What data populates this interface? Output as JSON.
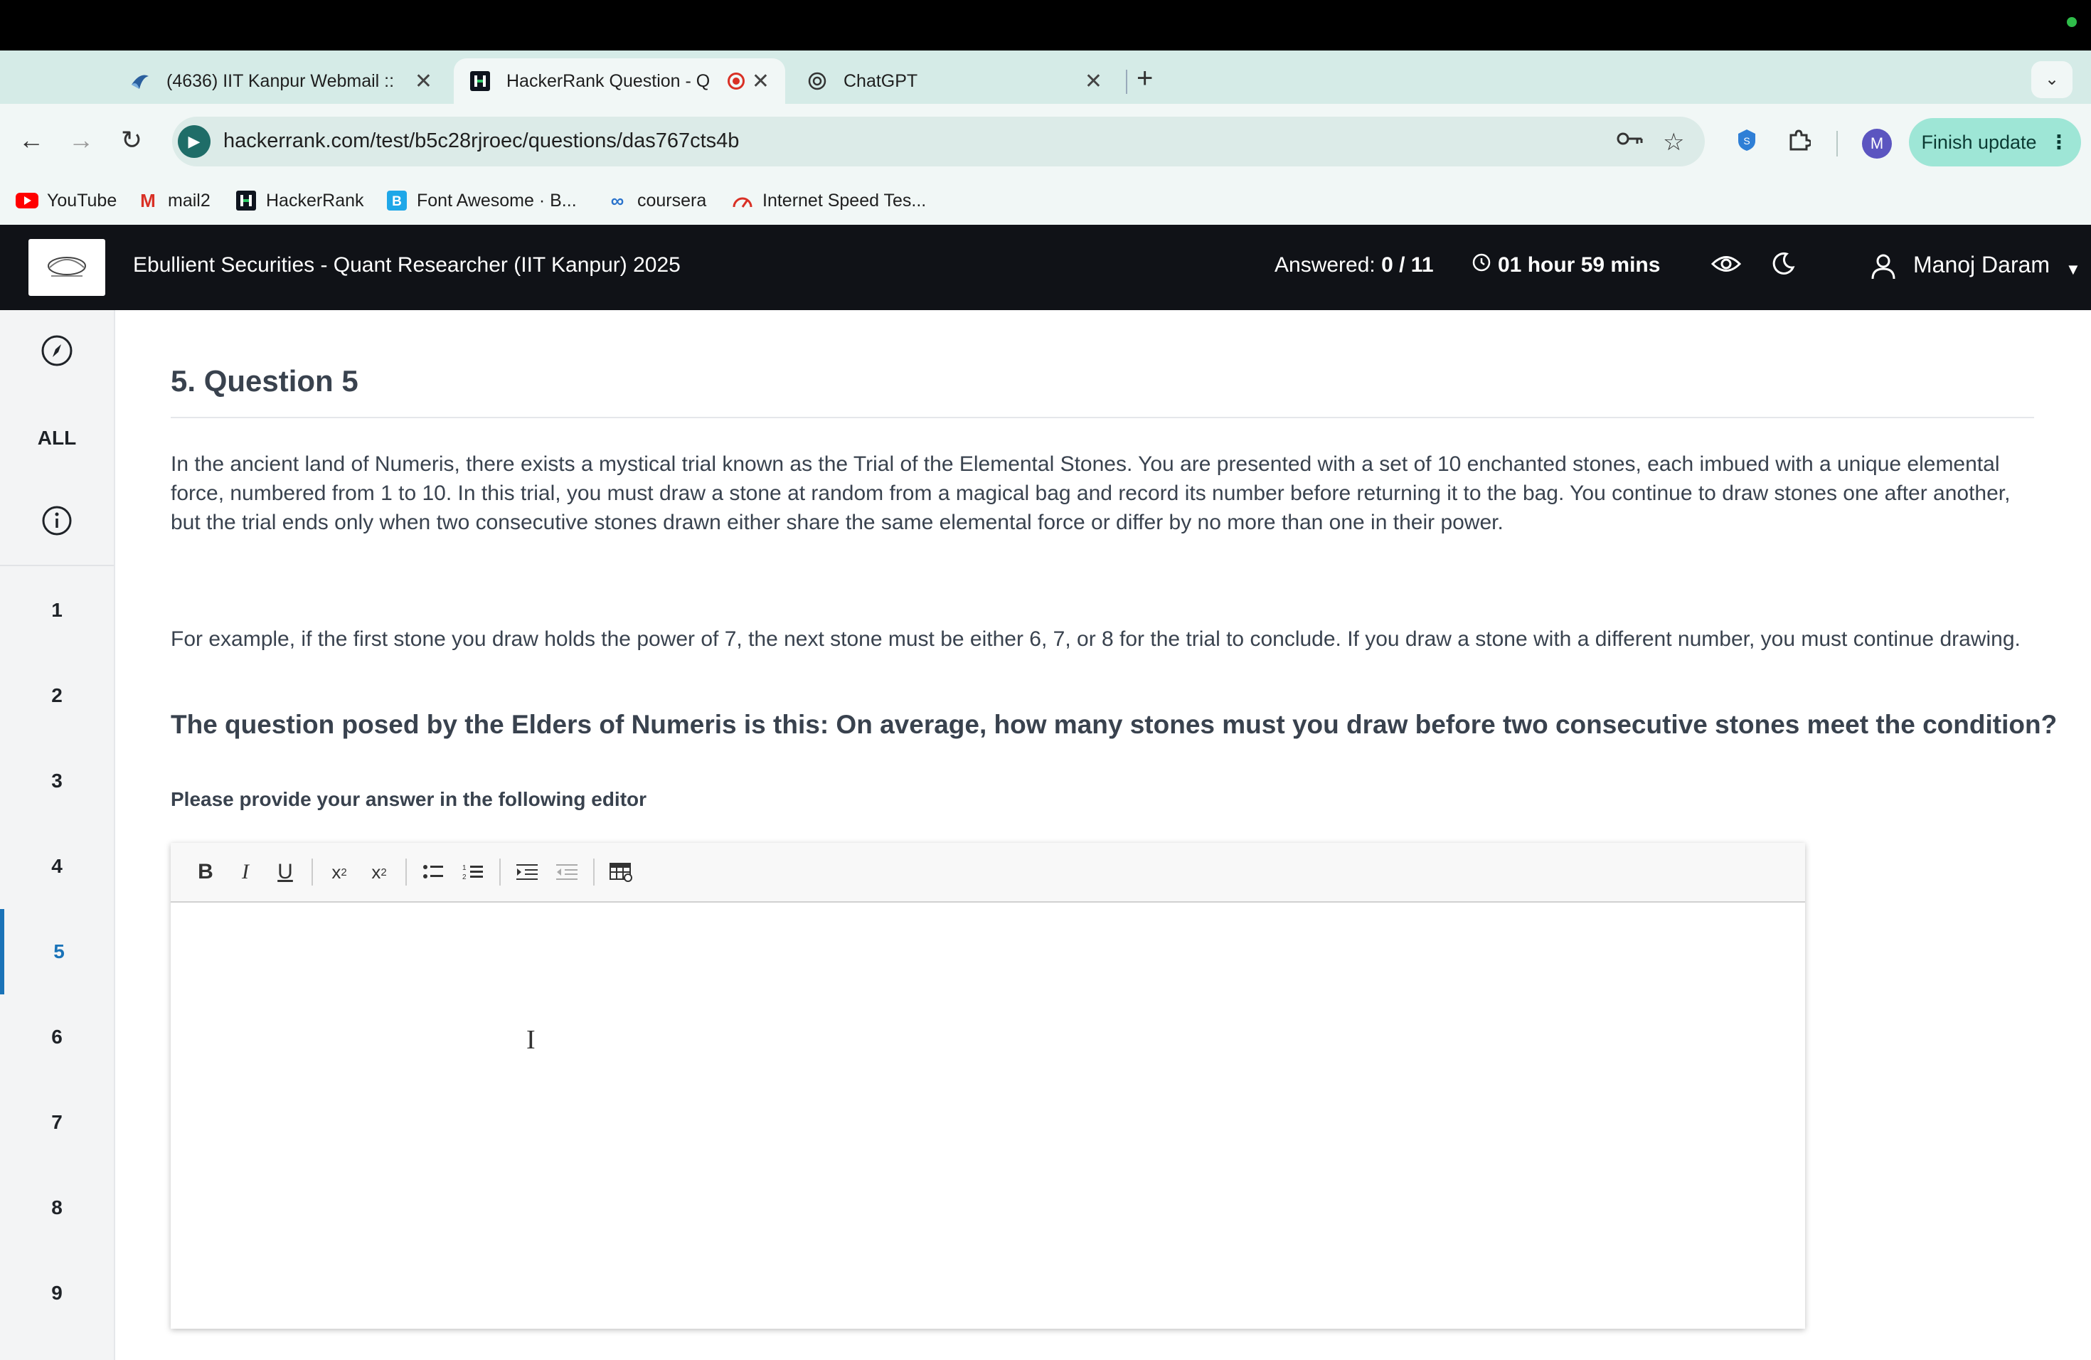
{
  "browser": {
    "tabs": [
      {
        "title": "(4636) IIT Kanpur Webmail ::",
        "favicon": "webmail-icon",
        "active": false
      },
      {
        "title": "HackerRank Question - Q",
        "favicon": "hackerrank-icon",
        "active": true
      },
      {
        "title": "ChatGPT",
        "favicon": "chatgpt-icon",
        "active": false
      }
    ],
    "url": "hackerrank.com/test/b5c28rjroec/questions/das767cts4b",
    "finish_update": "Finish update",
    "avatar_letter": "M",
    "bookmarks": [
      {
        "label": "YouTube",
        "icon": "youtube-icon"
      },
      {
        "label": "mail2",
        "icon": "gmail-icon"
      },
      {
        "label": "HackerRank",
        "icon": "hackerrank-icon"
      },
      {
        "label": "Font Awesome · B...",
        "icon": "bootstrap-icon"
      },
      {
        "label": "coursera",
        "icon": "coursera-icon"
      },
      {
        "label": "Internet Speed Tes...",
        "icon": "speedtest-icon"
      }
    ]
  },
  "header": {
    "test_title": "Ebullient Securities - Quant Researcher (IIT Kanpur) 2025",
    "answered_label": "Answered:",
    "answered_value": "0 / 11",
    "timer": "01 hour 59 mins",
    "user_name": "Manoj Daram"
  },
  "sidebar": {
    "all_label": "ALL",
    "questions": [
      "1",
      "2",
      "3",
      "4",
      "5",
      "6",
      "7",
      "8",
      "9"
    ],
    "active_question": "5"
  },
  "question": {
    "title": "5. Question 5",
    "paragraph1": "In the ancient land of Numeris, there exists a mystical trial known as the Trial of the Elemental Stones. You are presented with a set of 10 enchanted stones, each imbued with a unique elemental force, numbered from 1 to 10. In this trial, you must draw a stone at random from a magical bag and record its number before returning it to the bag. You continue to draw stones one after another, but the trial ends only when two consecutive stones drawn either share the same elemental force or differ by no more than one in their power.",
    "paragraph2": "For example, if the first stone you draw holds the power of 7, the next stone must be either 6, 7, or 8 for the trial to conclude. If you draw a stone with a different number, you must continue drawing.",
    "bold_question": "The question posed by the Elders of Numeris is this: On average, how many stones must you draw before two consecutive stones meet the condition?",
    "editor_prompt": "Please provide your answer in the following editor"
  },
  "colors": {
    "accent": "#1a73b8",
    "header_bg": "#101217",
    "tabstrip_bg": "#d5ebe7",
    "finish_update_bg": "#9ee6d6"
  }
}
